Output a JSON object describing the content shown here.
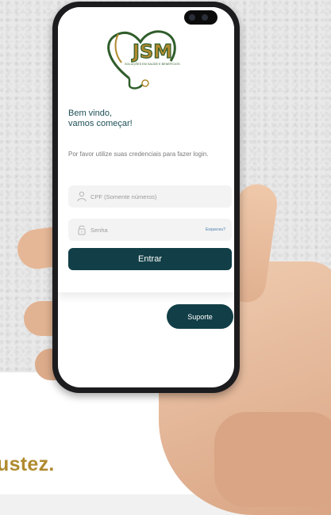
{
  "logo": {
    "brand": "JSM",
    "tagline": "SOLUÇÕES EM SAÚDE E BENEFÍCIOS"
  },
  "login": {
    "welcome_line1": "Bem vindo,",
    "welcome_line2": "vamos começar!",
    "instructions": "Por favor utilize suas credenciais para fazer login.",
    "cpf_placeholder": "CPF (Somente números)",
    "password_placeholder": "Senha",
    "forgot_label": "Esqueceu?",
    "submit_label": "Entrar"
  },
  "support_label": "Suporte",
  "slogan": "ustez.",
  "colors": {
    "primary": "#123f47",
    "brand_gold": "#b08a2e",
    "brand_green": "#2f5d2a"
  }
}
